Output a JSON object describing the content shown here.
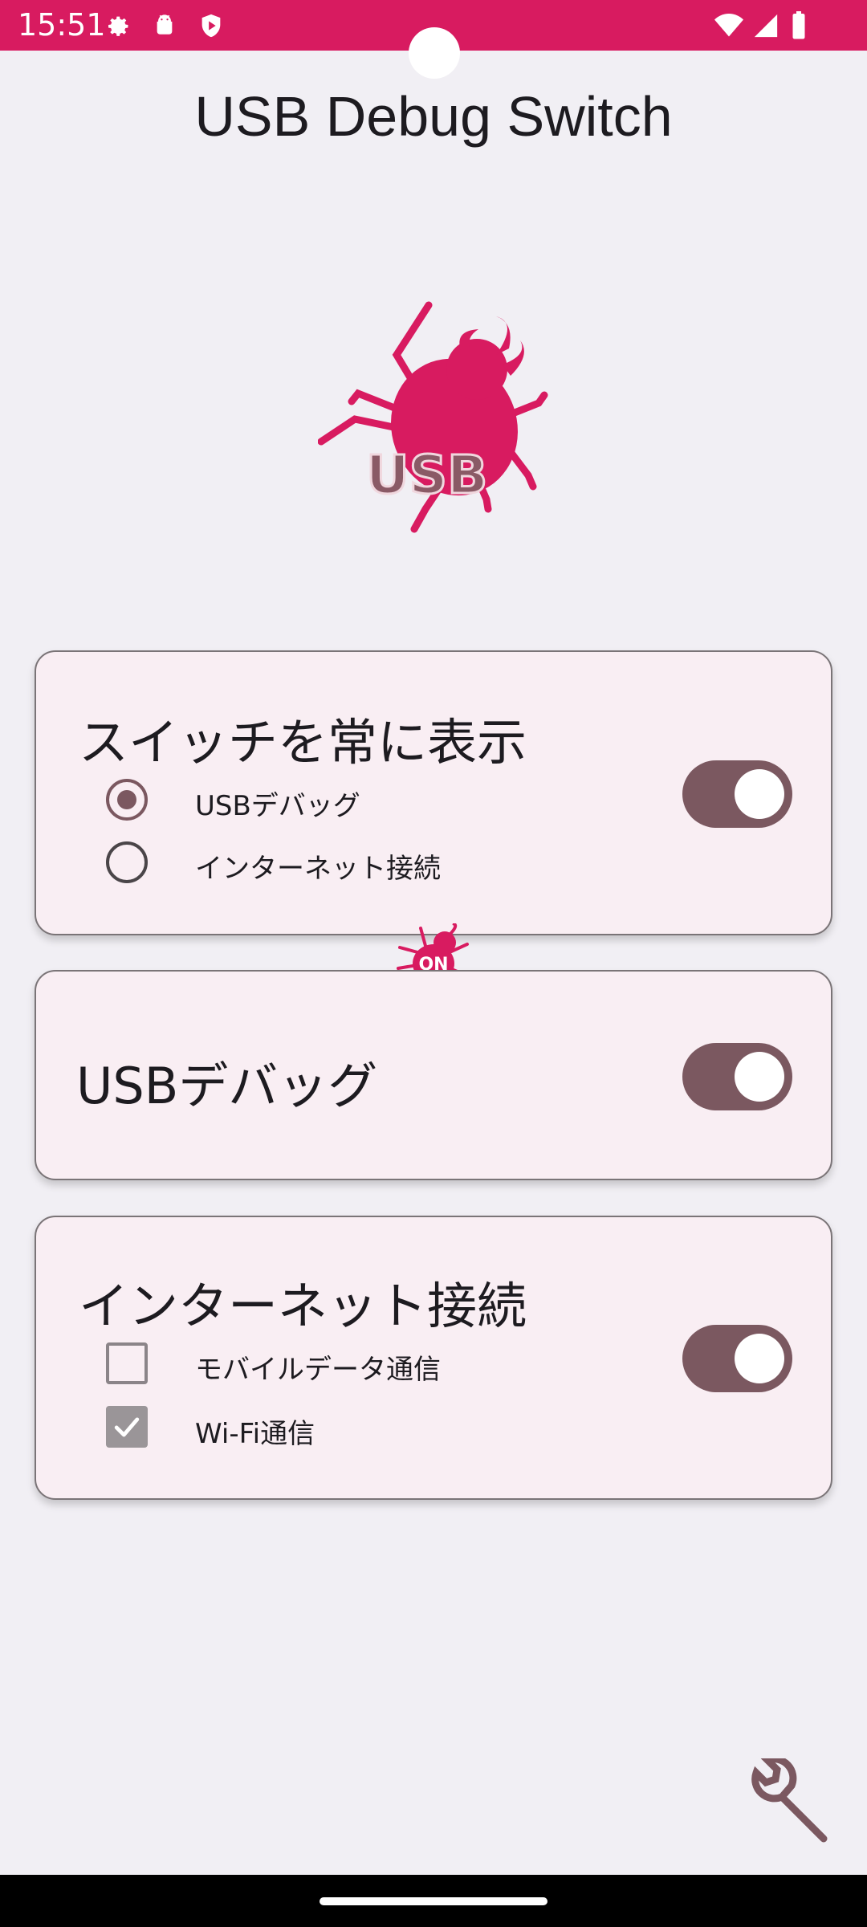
{
  "status_bar": {
    "time": "15:51",
    "color": "#d81b60",
    "left_icons": [
      "gear-icon",
      "android-icon",
      "shield-icon"
    ],
    "right_icons": [
      "wifi-icon",
      "cellular-signal-icon",
      "battery-icon"
    ]
  },
  "app": {
    "title": "USB Debug Switch",
    "logo_text": "USB",
    "accent": "#d81b60"
  },
  "cards": [
    {
      "title": "スイッチを常に表示",
      "toggle_on": true,
      "options": [
        {
          "label": "USBデバッグ",
          "type": "radio",
          "checked": true
        },
        {
          "label": "インターネット接続",
          "type": "radio",
          "checked": false
        }
      ]
    },
    {
      "title": "USBデバッグ",
      "toggle_on": true,
      "badge_text": "ON"
    },
    {
      "title": "インターネット接続",
      "toggle_on": true,
      "options": [
        {
          "label": "モバイルデータ通信",
          "type": "checkbox",
          "checked": false
        },
        {
          "label": "Wi-Fi通信",
          "type": "checkbox",
          "checked": true
        }
      ]
    }
  ],
  "fab": {
    "icon": "wrench-icon"
  }
}
